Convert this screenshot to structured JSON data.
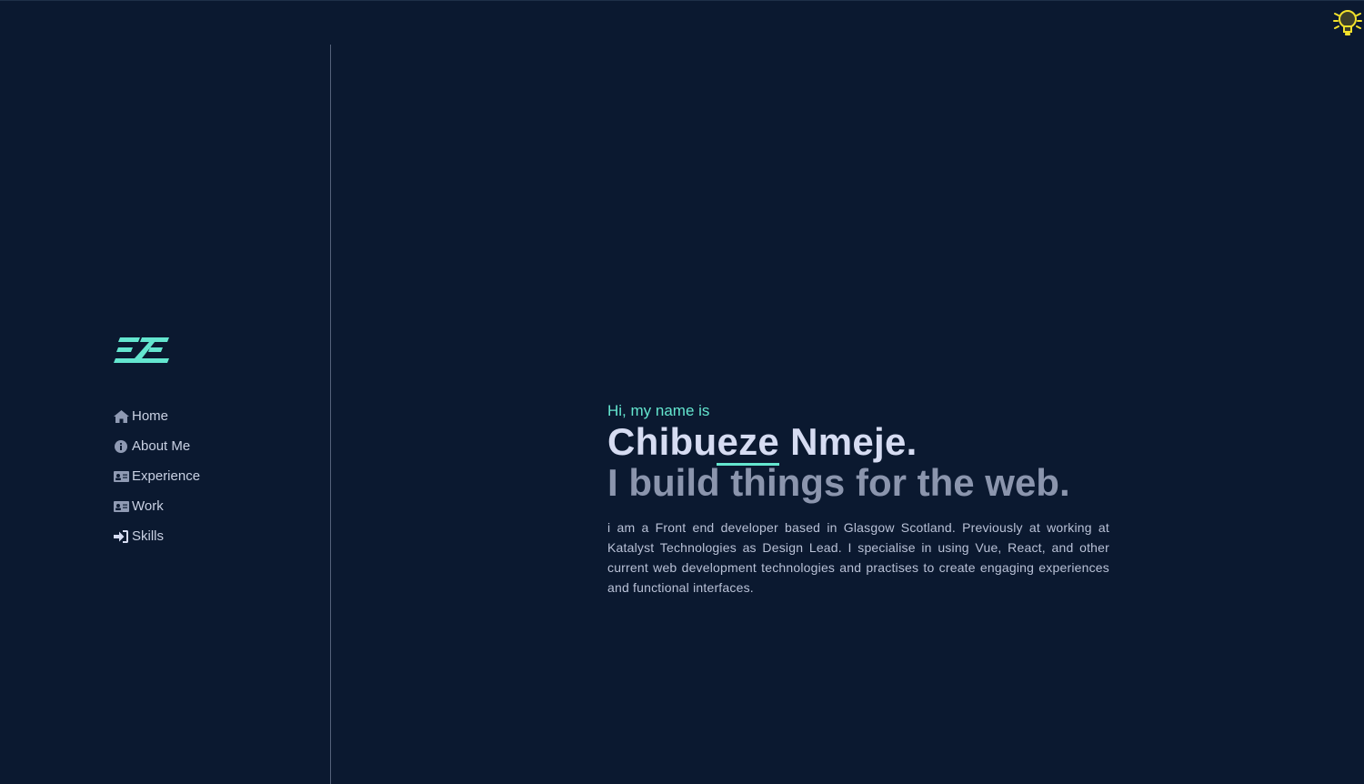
{
  "nav": {
    "items": [
      {
        "label": "Home",
        "icon": "home-icon"
      },
      {
        "label": "About Me",
        "icon": "info-icon"
      },
      {
        "label": "Experience",
        "icon": "id-card-icon"
      },
      {
        "label": "Work",
        "icon": "id-card-icon"
      },
      {
        "label": "Skills",
        "icon": "sign-in-icon"
      }
    ]
  },
  "hero": {
    "greeting": "Hi, my name is",
    "name_first_part": "Chibu",
    "name_highlight": "eze",
    "name_rest": " Nmeje.",
    "tagline": "I build things for the web.",
    "intro": "i am a Front end developer based in Glasgow Scotland. Previously at working at Katalyst Technologies as Design Lead. I specialise in using Vue, React, and other current web development technologies and practises to create engaging experiences and functional interfaces."
  },
  "colors": {
    "background": "#0b1930",
    "accent": "#64e6cf",
    "heading": "#d6dcf2",
    "muted": "#8b95ad",
    "bulb": "#f2e12b"
  },
  "icons": {
    "theme_toggle": "lightbulb-icon",
    "logo": "ze-logo"
  }
}
